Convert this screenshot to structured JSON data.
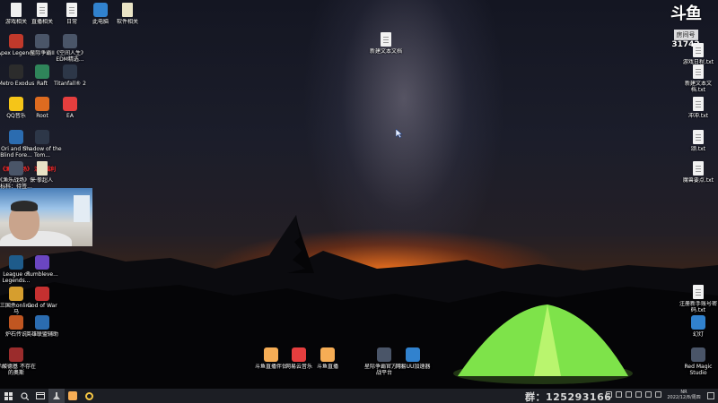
{
  "desktop": {
    "left_column_icons": [
      {
        "label": "游戏相关",
        "icon": "folder-icon",
        "color": "#f0f0f0"
      },
      {
        "label": "Apex Legends",
        "icon": "apex-icon",
        "color": "#c0392b"
      },
      {
        "label": "Metro Exodus",
        "icon": "metro-icon",
        "color": "#2c2c2c"
      },
      {
        "label": "QQ音乐",
        "icon": "qqmusic-icon",
        "color": "#f5c518"
      },
      {
        "label": "Ori and the Blind Fore...",
        "icon": "ori-icon",
        "color": "#2b6cb0"
      },
      {
        "label": "《渔乐战场》保 标科：待签...",
        "icon": "game-icon",
        "color": "#4a5568"
      },
      {
        "label": "League of Legends...",
        "icon": "lol-icon",
        "color": "#1e5b8a"
      },
      {
        "label": "三国杀online 马",
        "icon": "sgs-icon",
        "color": "#d69e2e"
      },
      {
        "label": "炉石传说",
        "icon": "hearthstone-icon",
        "color": "#c05621"
      },
      {
        "label": "赤酸德基 不存在的奥斯",
        "icon": "game2-icon",
        "color": "#9b2c2c"
      }
    ],
    "second_column_icons": [
      {
        "label": "直播相关",
        "icon": "file-icon",
        "color": "#f2f2f2"
      },
      {
        "label": "星际争霸II",
        "icon": "starcraft-icon",
        "color": "#4a5568"
      },
      {
        "label": "Raft",
        "icon": "raft-icon",
        "color": "#2f855a"
      },
      {
        "label": "Root",
        "icon": "root-icon",
        "color": "#dd6b20"
      },
      {
        "label": "Shadow of the Tom...",
        "icon": "tombraider-icon",
        "color": "#2d3748"
      },
      {
        "label": "一拳超人",
        "icon": "zip-icon",
        "color": "#e9e3c6"
      },
      {
        "label": "Rumbleve...",
        "icon": "rumbleverse-icon",
        "color": "#6b46c1"
      },
      {
        "label": "God of War",
        "icon": "gow-icon",
        "color": "#c53030"
      },
      {
        "label": "英雄联盟辅助",
        "icon": "lolhelper-icon",
        "color": "#2b6cb0"
      }
    ],
    "top_row_icons": [
      {
        "label": "日常",
        "icon": "file-icon",
        "color": "#f2f2f2"
      },
      {
        "label": "此电脑",
        "icon": "computer-icon",
        "color": "#3182ce"
      },
      {
        "label": "软件相关",
        "icon": "zip-icon",
        "color": "#e9e3c6"
      }
    ],
    "third_column_icons": [
      {
        "label": "《空间人生》 EDM精选...",
        "icon": "edm-icon",
        "color": "#4a5568"
      },
      {
        "label": "Titanfall® 2",
        "icon": "titanfall-icon",
        "color": "#2d3748"
      },
      {
        "label": "EA",
        "icon": "ea-icon",
        "color": "#e53e3e"
      }
    ],
    "center_file": {
      "label": "新建文本文档",
      "icon": "text-file-icon"
    },
    "bottom_icons": [
      {
        "label": "斗鱼直播伴侣",
        "icon": "douyu-icon",
        "color": "#f6ad55"
      },
      {
        "label": "网易云音乐",
        "icon": "netease-icon",
        "color": "#e53e3e"
      },
      {
        "label": "斗鱼直播",
        "icon": "douyu2-icon",
        "color": "#f6ad55"
      },
      {
        "label": "星际争霸官方 对战平台",
        "icon": "battlenet-icon",
        "color": "#4a5568"
      },
      {
        "label": "网易UU加速器",
        "icon": "uu-icon",
        "color": "#3182ce"
      }
    ],
    "right_column_icons": [
      {
        "label": "游戏日程.txt",
        "icon": "text-file-icon"
      },
      {
        "label": "新建文本文档.txt",
        "icon": "text-file-icon"
      },
      {
        "label": "冲冲.txt",
        "icon": "text-file-icon"
      },
      {
        "label": "颂.txt",
        "icon": "text-file-icon"
      },
      {
        "label": "魔兽要点.txt",
        "icon": "text-file-icon"
      },
      {
        "label": "注册新手账号密码.txt",
        "icon": "text-file-icon"
      },
      {
        "label": "幻灯",
        "icon": "slides-icon",
        "color": "#3182ce"
      },
      {
        "label": "Red Magic Studio",
        "icon": "redmagic-icon",
        "color": "#4a5568"
      }
    ]
  },
  "red_overlay_text": "《渔乐战场》 活动福利",
  "watermark": {
    "logo": "斗鱼",
    "room_label": "房间号",
    "room_number": "31742"
  },
  "taskbar": {
    "group_text": "群：125293166",
    "clock_time": "NR",
    "clock_date": "2022/12/8/周四"
  }
}
